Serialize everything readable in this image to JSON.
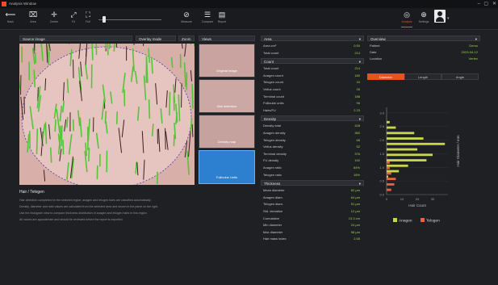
{
  "window": {
    "title": "Analysis Window",
    "accent": "#e8521e"
  },
  "toolbar": {
    "items": [
      {
        "icon": "back-arrow-icon",
        "label": "Back"
      },
      {
        "icon": "crop-icon",
        "label": "Area"
      },
      {
        "icon": "crosshair-icon",
        "label": "Center"
      },
      {
        "icon": "expand-icon",
        "label": "Fit"
      },
      {
        "icon": "fullscreen-icon",
        "label": "Full"
      },
      {
        "icon": "measure-icon",
        "label": "Measure"
      },
      {
        "icon": "compare-icon",
        "label": "Compare"
      },
      {
        "icon": "report-icon",
        "label": "Report"
      }
    ],
    "right_items": [
      {
        "icon": "gauge-icon",
        "label": "Analysis"
      },
      {
        "icon": "target-icon",
        "label": "Settings"
      }
    ]
  },
  "image_panel": {
    "select_label": "Source image",
    "select2_label": "Overlay mode",
    "zoom_label": "Zoom"
  },
  "thumbs": {
    "header": "Views",
    "items": [
      "Original image",
      "Hair detection",
      "Density map",
      "Follicular Units"
    ]
  },
  "notes": {
    "title": "Hair / Telogen",
    "lines": [
      "Hair detection completed for the selected region; anagen and telogen hairs are classified automatically.",
      "Density, diameter and ratio values are calculated from the selected area and shown in the panel on the right.",
      "Use the histogram view to compare thickness distribution of anagen and telogen hairs in this region.",
      "All values are approximate and should be reviewed before the report is exported."
    ]
  },
  "stats": {
    "sections": [
      {
        "title": "Area",
        "rows": [
          [
            "Area cm²",
            "0.50"
          ],
          [
            "Total count",
            "214"
          ]
        ]
      },
      {
        "title": "Count",
        "rows": [
          [
            "Total count",
            "214"
          ],
          [
            "Anagen count",
            "180"
          ],
          [
            "Telogen count",
            "34"
          ],
          [
            "Vellus count",
            "26"
          ],
          [
            "Terminal count",
            "188"
          ],
          [
            "Follicular units",
            "96"
          ],
          [
            "Hairs/FU",
            "2.23"
          ]
        ]
      },
      {
        "title": "Density",
        "rows": [
          [
            "Density total",
            "428"
          ],
          [
            "Anagen density",
            "360"
          ],
          [
            "Telogen density",
            "68"
          ],
          [
            "Vellus density",
            "52"
          ],
          [
            "Terminal density",
            "376"
          ],
          [
            "FU density",
            "192"
          ],
          [
            "Anagen ratio",
            "84%"
          ],
          [
            "Telogen ratio",
            "16%"
          ]
        ]
      },
      {
        "title": "Thickness",
        "rows": [
          [
            "Mean diameter",
            "62 µm"
          ],
          [
            "Anagen diam.",
            "64 µm"
          ],
          [
            "Telogen diam.",
            "51 µm"
          ],
          [
            "Std. deviation",
            "12 µm"
          ],
          [
            "Cumulative",
            "13.3 cm"
          ],
          [
            "Min diameter",
            "24 µm"
          ],
          [
            "Max diameter",
            "98 µm"
          ],
          [
            "Hair mass index",
            "2.65"
          ]
        ]
      }
    ]
  },
  "overview": {
    "header": "Overview",
    "rows": [
      [
        "Patient",
        "Demo"
      ],
      [
        "Date",
        "2023-04-12"
      ],
      [
        "Location",
        "Vertex"
      ]
    ],
    "tabs": [
      "Diameter",
      "Length",
      "Angle"
    ],
    "active_tab": 0
  },
  "chart_data": {
    "type": "bar",
    "orientation": "horizontal",
    "categories": [
      "0.2",
      "0.4",
      "0.6",
      "0.8",
      "1.0",
      "1.2",
      "1.4",
      "1.6",
      "1.8",
      "2.0",
      "2.2",
      "2.4",
      "2.6",
      "2.8",
      "3.0"
    ],
    "series": [
      {
        "name": "Anagen",
        "color": "#c8d64a",
        "values": [
          0,
          0,
          1,
          8,
          14,
          26,
          30,
          20,
          38,
          24,
          18,
          6,
          2,
          0,
          0
        ]
      },
      {
        "name": "Telogen",
        "color": "#e8643a",
        "values": [
          3,
          5,
          6,
          3,
          2,
          2,
          0,
          0,
          0,
          0,
          0,
          0,
          0,
          0,
          0
        ]
      }
    ],
    "xlabel": "Hair Count",
    "ylabel": "Hair Diameter / mm",
    "xticks": [
      "0",
      "10",
      "20",
      "30"
    ],
    "yticks": [
      "0.0",
      "0.5",
      "1.0",
      "1.5",
      "2.0",
      "2.5",
      "3.0"
    ],
    "xlim": [
      0,
      40
    ],
    "ylim": [
      0,
      3.2
    ],
    "legend": "bottom"
  }
}
